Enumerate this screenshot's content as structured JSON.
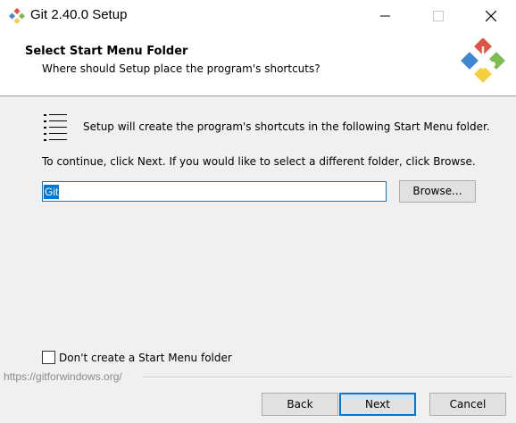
{
  "window": {
    "title": "Git 2.40.0 Setup",
    "controls": {
      "minimize": "minimize-icon",
      "maximize": "maximize-icon",
      "close": "close-icon"
    }
  },
  "header": {
    "title": "Select Start Menu Folder",
    "subtitle": "Where should Setup place the program's shortcuts?",
    "logo_icon": "git-logo"
  },
  "body": {
    "info_icon": "list-icon",
    "info": "Setup will create the program's shortcuts in the following Start Menu folder.",
    "instruction": "To continue, click Next. If you would like to select a different folder, click Browse.",
    "folder_value": "Git",
    "browse_label": "Browse...",
    "no_folder_checkbox": {
      "label": "Don't create a Start Menu folder",
      "checked": false
    }
  },
  "footer": {
    "link": "https://gitforwindows.org/",
    "back_label": "Back",
    "next_label": "Next",
    "cancel_label": "Cancel"
  },
  "colors": {
    "accent": "#0078d7",
    "git_red": "#e05243",
    "git_green": "#7bbd4f",
    "git_blue": "#3f86d3",
    "git_yellow": "#f5cf40"
  }
}
